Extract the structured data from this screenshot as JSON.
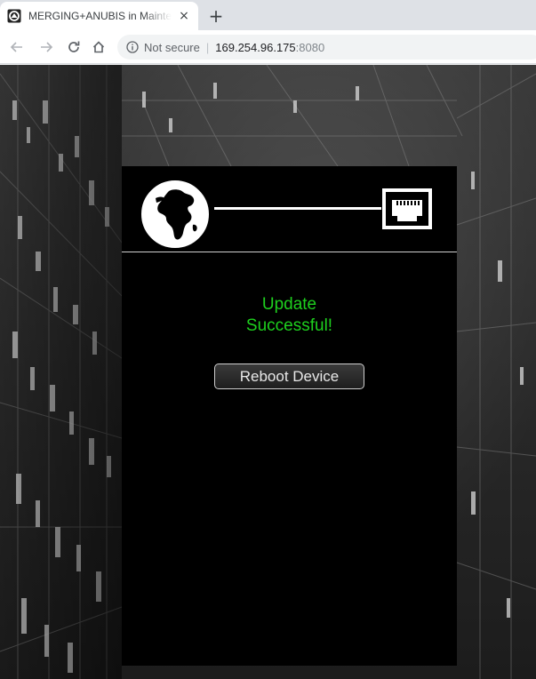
{
  "browser": {
    "tab": {
      "title": "MERGING+ANUBIS in Maintenance",
      "close_glyph": "×",
      "favicon": "merging-logo-icon"
    },
    "new_tab_glyph": "+",
    "nav": {
      "back": "arrow-left-icon",
      "forward": "arrow-right-icon",
      "reload": "reload-icon",
      "home": "home-icon"
    },
    "address": {
      "security_label": "Not secure",
      "separator": "|",
      "host": "169.254.96.175",
      "port": ":8080"
    }
  },
  "page": {
    "status": {
      "line1": "Update",
      "line2": "Successful!",
      "color": "#1ed01e"
    },
    "reboot_button_label": "Reboot Device",
    "header_icons": {
      "left": "globe-icon",
      "right": "ethernet-port-icon"
    }
  }
}
